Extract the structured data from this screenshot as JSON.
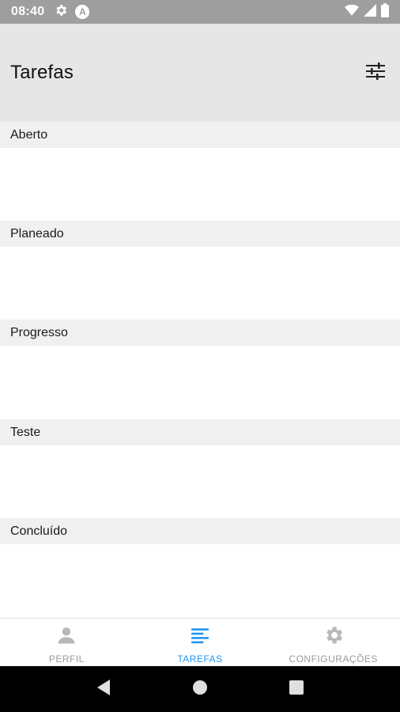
{
  "status_bar": {
    "time": "08:40",
    "badge_letter": "A",
    "icons": [
      "settings-icon",
      "a-badge-icon",
      "wifi-icon",
      "signal-icon",
      "battery-icon"
    ]
  },
  "app_bar": {
    "title": "Tarefas",
    "filter_icon": "tune-icon"
  },
  "sections": [
    {
      "label": "Aberto"
    },
    {
      "label": "Planeado"
    },
    {
      "label": "Progresso"
    },
    {
      "label": "Teste"
    },
    {
      "label": "Concluído"
    }
  ],
  "bottom_nav": {
    "items": [
      {
        "label": "PERFIL",
        "icon": "person-icon",
        "active": false
      },
      {
        "label": "TAREFAS",
        "icon": "list-icon",
        "active": true
      },
      {
        "label": "CONFIGURAÇÕES",
        "icon": "gear-icon",
        "active": false
      }
    ],
    "active_color": "#2196f3",
    "inactive_color": "#9a9a9a"
  },
  "system_nav": {
    "icons": [
      "back-icon",
      "home-icon",
      "recents-icon"
    ]
  }
}
